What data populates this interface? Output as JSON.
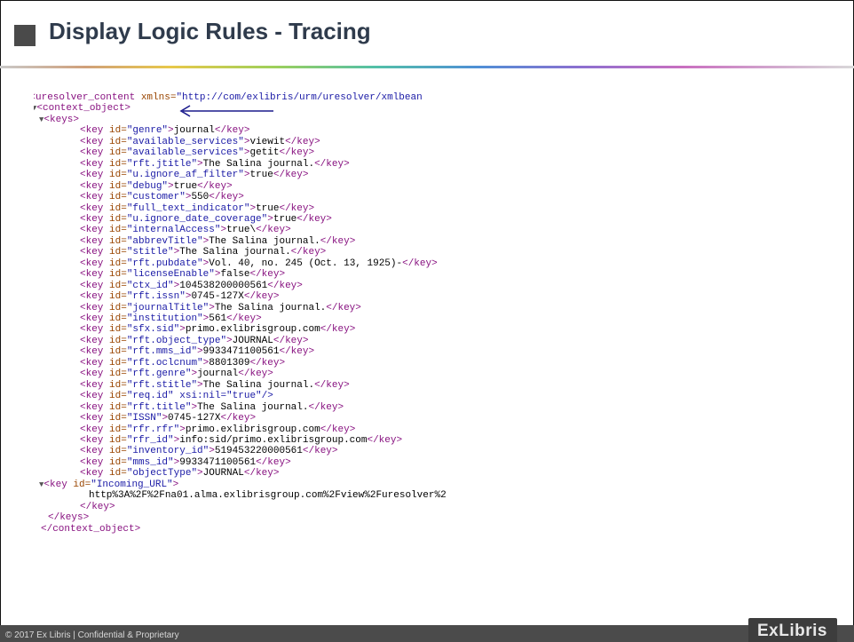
{
  "slide": {
    "title": "Display Logic Rules - Tracing",
    "footer": "© 2017 Ex Libris | Confidential & Proprietary",
    "logo": "ExLibris"
  },
  "xml": {
    "lines": [
      {
        "indent": 0,
        "toggle": true,
        "pre": "",
        "tag_open": "<uresolver_content ",
        "attr": "xmlns=",
        "val": "\"http://com/exlibris/urm/uresolver/xmlbean",
        "text": "",
        "tag_close": ""
      },
      {
        "indent": 1,
        "toggle": true,
        "pre": "",
        "tag_open": "<context_object>",
        "attr": "",
        "val": "",
        "text": "",
        "tag_close": ""
      },
      {
        "indent": 2,
        "toggle": true,
        "pre": "",
        "tag_open": "<keys>",
        "attr": "",
        "val": "",
        "text": "",
        "tag_close": ""
      },
      {
        "indent": 3,
        "toggle": false,
        "pre": "",
        "tag_open": "<key ",
        "attr": "id=",
        "val": "\"genre\"",
        "text": "journal",
        "tag_close": "</key>"
      },
      {
        "indent": 3,
        "toggle": false,
        "pre": "",
        "tag_open": "<key ",
        "attr": "id=",
        "val": "\"available_services\"",
        "text": "viewit",
        "tag_close": "</key>"
      },
      {
        "indent": 3,
        "toggle": false,
        "pre": "",
        "tag_open": "<key ",
        "attr": "id=",
        "val": "\"available_services\"",
        "text": "getit",
        "tag_close": "</key>"
      },
      {
        "indent": 3,
        "toggle": false,
        "pre": "",
        "tag_open": "<key ",
        "attr": "id=",
        "val": "\"rft.jtitle\"",
        "text": "The Salina journal.",
        "tag_close": "</key>"
      },
      {
        "indent": 3,
        "toggle": false,
        "pre": "",
        "tag_open": "<key ",
        "attr": "id=",
        "val": "\"u.ignore_af_filter\"",
        "text": "true",
        "tag_close": "</key>"
      },
      {
        "indent": 3,
        "toggle": false,
        "pre": "",
        "tag_open": "<key ",
        "attr": "id=",
        "val": "\"debug\"",
        "text": "true",
        "tag_close": "</key>"
      },
      {
        "indent": 3,
        "toggle": false,
        "pre": "",
        "tag_open": "<key ",
        "attr": "id=",
        "val": "\"customer\"",
        "text": "550",
        "tag_close": "</key>"
      },
      {
        "indent": 3,
        "toggle": false,
        "pre": "",
        "tag_open": "<key ",
        "attr": "id=",
        "val": "\"full_text_indicator\"",
        "text": "true",
        "tag_close": "</key>"
      },
      {
        "indent": 3,
        "toggle": false,
        "pre": "",
        "tag_open": "<key ",
        "attr": "id=",
        "val": "\"u.ignore_date_coverage\"",
        "text": "true",
        "tag_close": "</key>"
      },
      {
        "indent": 3,
        "toggle": false,
        "pre": "",
        "tag_open": "<key ",
        "attr": "id=",
        "val": "\"internalAccess\"",
        "text": "true\\",
        "tag_close": "</key>"
      },
      {
        "indent": 3,
        "toggle": false,
        "pre": "",
        "tag_open": "<key ",
        "attr": "id=",
        "val": "\"abbrevTitle\"",
        "text": "The Salina journal.",
        "tag_close": "</key>"
      },
      {
        "indent": 3,
        "toggle": false,
        "pre": "",
        "tag_open": "<key ",
        "attr": "id=",
        "val": "\"stitle\"",
        "text": "The Salina journal.",
        "tag_close": "</key>"
      },
      {
        "indent": 3,
        "toggle": false,
        "pre": "",
        "tag_open": "<key ",
        "attr": "id=",
        "val": "\"rft.pubdate\"",
        "text": "Vol. 40, no. 245 (Oct. 13, 1925)-",
        "tag_close": "</key>"
      },
      {
        "indent": 3,
        "toggle": false,
        "pre": "",
        "tag_open": "<key ",
        "attr": "id=",
        "val": "\"licenseEnable\"",
        "text": "false",
        "tag_close": "</key>"
      },
      {
        "indent": 3,
        "toggle": false,
        "pre": "",
        "tag_open": "<key ",
        "attr": "id=",
        "val": "\"ctx_id\"",
        "text": "104538200000561",
        "tag_close": "</key>"
      },
      {
        "indent": 3,
        "toggle": false,
        "pre": "",
        "tag_open": "<key ",
        "attr": "id=",
        "val": "\"rft.issn\"",
        "text": "0745-127X",
        "tag_close": "</key>"
      },
      {
        "indent": 3,
        "toggle": false,
        "pre": "",
        "tag_open": "<key ",
        "attr": "id=",
        "val": "\"journalTitle\"",
        "text": "The Salina journal.",
        "tag_close": "</key>"
      },
      {
        "indent": 3,
        "toggle": false,
        "pre": "",
        "tag_open": "<key ",
        "attr": "id=",
        "val": "\"institution\"",
        "text": "561",
        "tag_close": "</key>"
      },
      {
        "indent": 3,
        "toggle": false,
        "pre": "",
        "tag_open": "<key ",
        "attr": "id=",
        "val": "\"sfx.sid\"",
        "text": "primo.exlibrisgroup.com",
        "tag_close": "</key>"
      },
      {
        "indent": 3,
        "toggle": false,
        "pre": "",
        "tag_open": "<key ",
        "attr": "id=",
        "val": "\"rft.object_type\"",
        "text": "JOURNAL",
        "tag_close": "</key>"
      },
      {
        "indent": 3,
        "toggle": false,
        "pre": "",
        "tag_open": "<key ",
        "attr": "id=",
        "val": "\"rft.mms_id\"",
        "text": "9933471100561",
        "tag_close": "</key>"
      },
      {
        "indent": 3,
        "toggle": false,
        "pre": "",
        "tag_open": "<key ",
        "attr": "id=",
        "val": "\"rft.oclcnum\"",
        "text": "8801309",
        "tag_close": "</key>"
      },
      {
        "indent": 3,
        "toggle": false,
        "pre": "",
        "tag_open": "<key ",
        "attr": "id=",
        "val": "\"rft.genre\"",
        "text": "journal",
        "tag_close": "</key>"
      },
      {
        "indent": 3,
        "toggle": false,
        "pre": "",
        "tag_open": "<key ",
        "attr": "id=",
        "val": "\"rft.stitle\"",
        "text": "The Salina journal.",
        "tag_close": "</key>"
      },
      {
        "indent": 3,
        "toggle": false,
        "pre": "",
        "tag_open": "<key ",
        "attr": "id=",
        "val": "\"req.id\" xsi:nil=\"true\"/>",
        "text": "",
        "tag_close": ""
      },
      {
        "indent": 3,
        "toggle": false,
        "pre": "",
        "tag_open": "<key ",
        "attr": "id=",
        "val": "\"rft.title\"",
        "text": "The Salina journal.",
        "tag_close": "</key>"
      },
      {
        "indent": 3,
        "toggle": false,
        "pre": "",
        "tag_open": "<key ",
        "attr": "id=",
        "val": "\"ISSN\"",
        "text": "0745-127X",
        "tag_close": "</key>"
      },
      {
        "indent": 3,
        "toggle": false,
        "pre": "",
        "tag_open": "<key ",
        "attr": "id=",
        "val": "\"rfr.rfr\"",
        "text": "primo.exlibrisgroup.com",
        "tag_close": "</key>"
      },
      {
        "indent": 3,
        "toggle": false,
        "pre": "",
        "tag_open": "<key ",
        "attr": "id=",
        "val": "\"rfr_id\"",
        "text": "info:sid/primo.exlibrisgroup.com",
        "tag_close": "</key>"
      },
      {
        "indent": 3,
        "toggle": false,
        "pre": "",
        "tag_open": "<key ",
        "attr": "id=",
        "val": "\"inventory_id\"",
        "text": "519453220000561",
        "tag_close": "</key>"
      },
      {
        "indent": 3,
        "toggle": false,
        "pre": "",
        "tag_open": "<key ",
        "attr": "id=",
        "val": "\"mms_id\"",
        "text": "9933471100561",
        "tag_close": "</key>"
      },
      {
        "indent": 3,
        "toggle": false,
        "pre": "",
        "tag_open": "<key ",
        "attr": "id=",
        "val": "\"objectType\"",
        "text": "JOURNAL",
        "tag_close": "</key>"
      },
      {
        "indent": 2,
        "toggle": true,
        "pre": "",
        "tag_open": "<key ",
        "attr": "id=",
        "val": "\"Incoming_URL\"",
        "text": "",
        "tag_close": ""
      },
      {
        "indent": 4,
        "toggle": false,
        "pre": "",
        "tag_open": "",
        "attr": "",
        "val": "",
        "text": "http%3A%2F%2Fna01.alma.exlibrisgroup.com%2Fview%2Furesolver%2",
        "tag_close": ""
      },
      {
        "indent": 3,
        "toggle": false,
        "pre": "",
        "tag_open": "</key>",
        "attr": "",
        "val": "",
        "text": "",
        "tag_close": ""
      },
      {
        "indent": 2,
        "toggle": false,
        "pre": "",
        "tag_open": "</keys>",
        "attr": "",
        "val": "",
        "text": "",
        "tag_close": ""
      },
      {
        "indent": 1,
        "toggle": false,
        "pre": "",
        "tag_open": "</context_object>",
        "attr": "",
        "val": "",
        "text": "",
        "tag_close": ""
      }
    ]
  },
  "colors": {
    "tag": "#881280",
    "attr": "#994500",
    "value": "#1a1aa6",
    "arrow": "#1a1a8c",
    "footer_bg": "#4b4b4b"
  }
}
